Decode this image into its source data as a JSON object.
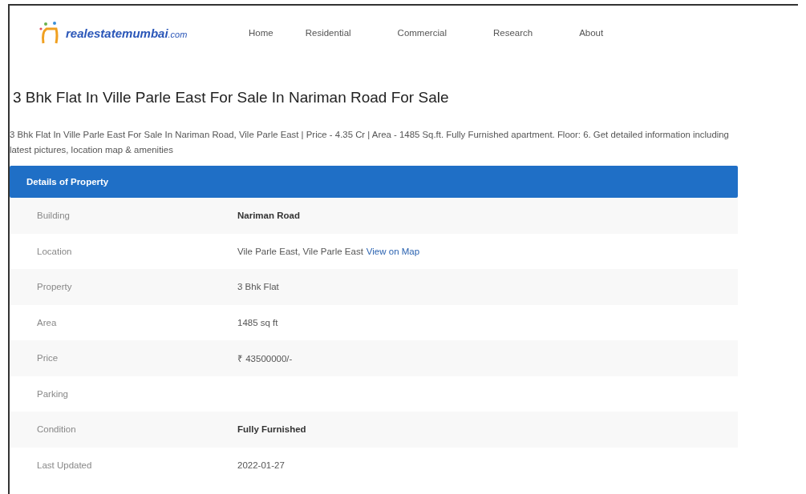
{
  "header": {
    "logo": {
      "name": "realestatemumbai",
      "suffix": ".com"
    },
    "nav": [
      {
        "label": "Home"
      },
      {
        "label": "Residential"
      },
      {
        "label": "Commercial"
      },
      {
        "label": "Research"
      },
      {
        "label": "About"
      }
    ]
  },
  "title": "3 Bhk Flat In Ville Parle East For Sale In Nariman Road For Sale",
  "description": "3 Bhk Flat In Ville Parle East For Sale In Nariman Road, Vile Parle East | Price - 4.35 Cr | Area - 1485 Sq.ft. Fully Furnished apartment. Floor: 6. Get detailed information including latest pictures, location map & amenities",
  "details": {
    "heading": "Details of Property",
    "rows": [
      {
        "label": "Building",
        "value": "Nariman Road",
        "bold": true
      },
      {
        "label": "Location",
        "value": "Vile Parle East, Vile Parle East",
        "link": "View on Map",
        "bold": false
      },
      {
        "label": "Property",
        "value": "3 Bhk Flat",
        "bold": false
      },
      {
        "label": "Area",
        "value": "1485 sq ft",
        "bold": false
      },
      {
        "label": "Price",
        "value": "₹ 43500000/-",
        "bold": false
      },
      {
        "label": "Parking"
      },
      {
        "label": "Condition",
        "value": "Fully Furnished",
        "bold": true
      },
      {
        "label": "Last Updated",
        "value": "2022-01-27",
        "bold": false
      }
    ]
  }
}
